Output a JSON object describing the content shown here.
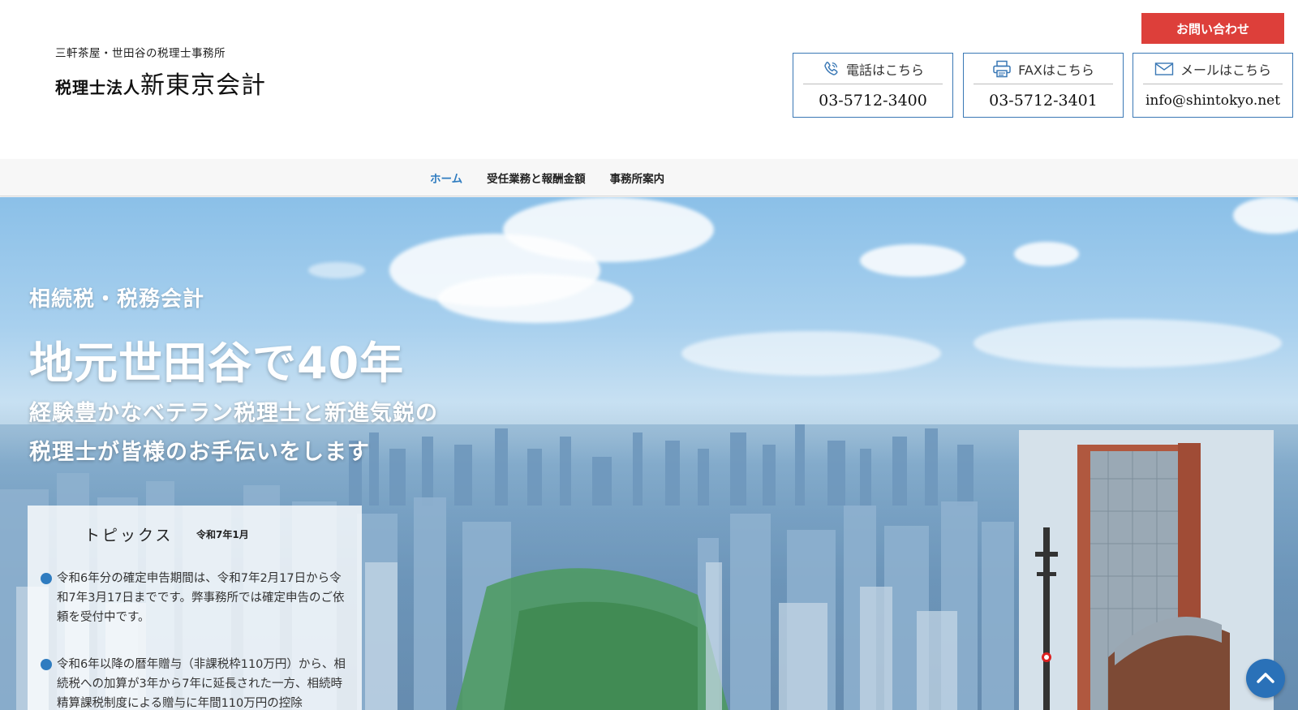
{
  "header": {
    "tagline": "三軒茶屋・世田谷の税理士事務所",
    "firm_prefix": "税理士法人",
    "firm_name": "新東京会計",
    "contact_button": "お問い合わせ",
    "phone": {
      "label": "電話はこちら",
      "value": "03-5712-3400",
      "icon": "phone-icon"
    },
    "fax": {
      "label": "FAXはこちら",
      "value": "03-5712-3401",
      "icon": "printer-icon"
    },
    "email": {
      "label": "メールはこちら",
      "value": "info@shintokyo.net",
      "icon": "envelope-icon"
    }
  },
  "nav": {
    "items": [
      {
        "label": "ホーム",
        "active": true
      },
      {
        "label": "受任業務と報酬金額",
        "active": false
      },
      {
        "label": "事務所案内",
        "active": false
      }
    ]
  },
  "hero": {
    "subtitle": "相続税・税務会計",
    "title": "地元世田谷で40年",
    "desc_line1": "経験豊かなベテラン税理士と新進気鋭の",
    "desc_line2": "税理士が皆様のお手伝いをします"
  },
  "topics": {
    "title": "トピックス",
    "date": "令和7年1月",
    "items": [
      "令和6年分の確定申告期間は、令和7年2月17日から令和7年3月17日までです。弊事務所では確定申告のご依頼を受付中です。",
      "令和6年以降の暦年贈与（非課税枠110万円）から、相続税への加算が3年から7年に延長された一方、相続時精算課税制度による贈与に年間110万円の控除"
    ]
  },
  "colors": {
    "accent": "#2f7cc0",
    "contact_button": "#dd3f3a",
    "box_border": "#3a78b5"
  },
  "scroll_top_icon": "chevron-up-icon"
}
